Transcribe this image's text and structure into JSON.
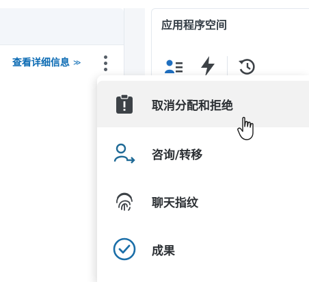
{
  "left_panel": {
    "details_link_label": "查看详细信息",
    "details_chevron": "≫",
    "more_icon": "more-vertical-icon"
  },
  "right_panel": {
    "title": "应用程序空间",
    "icons": [
      "assign-user-icon",
      "lightning-icon",
      "history-icon"
    ]
  },
  "menu": {
    "items": [
      {
        "label": "取消分配和拒绝",
        "icon": "clipboard-alert-icon",
        "hovered": true
      },
      {
        "label": "咨询/转移",
        "icon": "user-arrow-icon",
        "hovered": false
      },
      {
        "label": "聊天指纹",
        "icon": "fingerprint-icon",
        "hovered": false
      },
      {
        "label": "成果",
        "icon": "check-circle-icon",
        "hovered": false
      }
    ]
  },
  "colors": {
    "accent_blue": "#0a6ab3",
    "dark_text": "#2b2f33",
    "hover_bg": "#f2f2f2",
    "icon_dark": "#3d4247"
  }
}
